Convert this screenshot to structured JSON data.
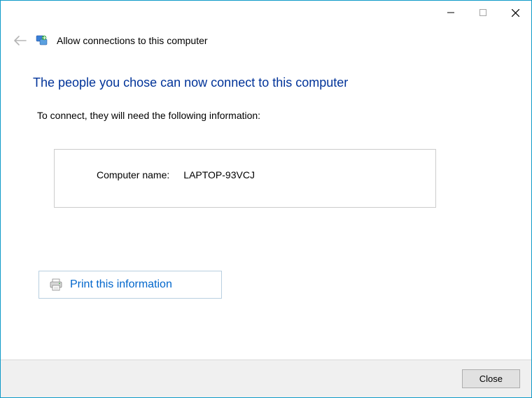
{
  "window": {
    "title": "Allow connections to this computer"
  },
  "heading": "The people you chose can now connect to this computer",
  "instruction": "To connect, they will need the following information:",
  "info": {
    "computer_name_label": "Computer name:",
    "computer_name_value": "LAPTOP-93VCJ"
  },
  "print_link": "Print this information",
  "footer": {
    "close_label": "Close"
  }
}
